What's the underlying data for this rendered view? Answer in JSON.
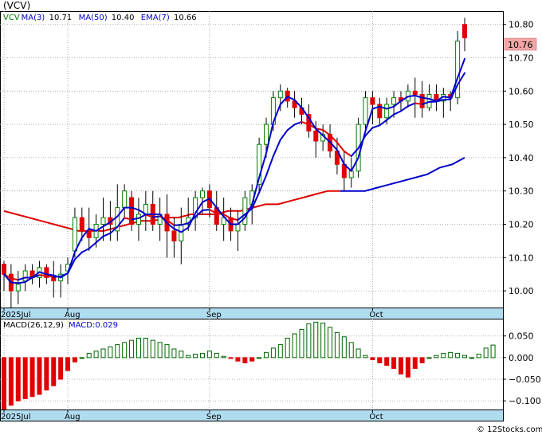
{
  "chart_data": [
    {
      "type": "candlestick",
      "ticker": "(VCV)",
      "legend": [
        {
          "label": "VCV",
          "color": "#008000"
        },
        {
          "label": "MA(3)",
          "value": "10.71",
          "color": "#0000cc"
        },
        {
          "label": "MA(50)",
          "value": "10.40",
          "color": "#0000cc"
        },
        {
          "label": "EMA(7)",
          "value": "10.66",
          "color": "#0000cc"
        }
      ],
      "last_price_label": "10.76",
      "ylim": [
        9.95,
        10.84
      ],
      "y_ticks": [
        10.0,
        10.1,
        10.2,
        10.3,
        10.4,
        10.5,
        10.6,
        10.7,
        10.8
      ],
      "x_ticks": [
        {
          "label": "2025Jul",
          "index": 0
        },
        {
          "label": "Aug",
          "index": 9
        },
        {
          "label": "Sep",
          "index": 29
        },
        {
          "label": "Oct",
          "index": 52
        }
      ],
      "ohlc": [
        [
          10.08,
          10.09,
          10.0,
          10.05
        ],
        [
          10.05,
          10.08,
          9.95,
          10.0
        ],
        [
          10.0,
          10.06,
          9.96,
          10.02
        ],
        [
          10.03,
          10.08,
          10.0,
          10.06
        ],
        [
          10.06,
          10.08,
          10.02,
          10.04
        ],
        [
          10.04,
          10.09,
          10.01,
          10.07
        ],
        [
          10.07,
          10.08,
          10.02,
          10.04
        ],
        [
          10.04,
          10.09,
          9.98,
          10.03
        ],
        [
          10.03,
          10.08,
          9.98,
          10.05
        ],
        [
          10.06,
          10.1,
          10.02,
          10.08
        ],
        [
          10.12,
          10.25,
          10.1,
          10.22
        ],
        [
          10.22,
          10.25,
          10.15,
          10.18
        ],
        [
          10.18,
          10.25,
          10.12,
          10.16
        ],
        [
          10.16,
          10.23,
          10.13,
          10.2
        ],
        [
          10.2,
          10.28,
          10.15,
          10.22
        ],
        [
          10.22,
          10.27,
          10.15,
          10.2
        ],
        [
          10.18,
          10.32,
          10.15,
          10.25
        ],
        [
          10.25,
          10.32,
          10.22,
          10.3
        ],
        [
          10.28,
          10.3,
          10.18,
          10.2
        ],
        [
          10.2,
          10.28,
          10.15,
          10.23
        ],
        [
          10.23,
          10.3,
          10.18,
          10.26
        ],
        [
          10.26,
          10.3,
          10.18,
          10.2
        ],
        [
          10.2,
          10.28,
          10.15,
          10.23
        ],
        [
          10.23,
          10.29,
          10.1,
          10.18
        ],
        [
          10.18,
          10.22,
          10.1,
          10.15
        ],
        [
          10.15,
          10.25,
          10.08,
          10.2
        ],
        [
          10.2,
          10.28,
          10.18,
          10.22
        ],
        [
          10.22,
          10.3,
          10.18,
          10.28
        ],
        [
          10.28,
          10.31,
          10.23,
          10.3
        ],
        [
          10.3,
          10.32,
          10.22,
          10.25
        ],
        [
          10.25,
          10.3,
          10.18,
          10.2
        ],
        [
          10.2,
          10.28,
          10.15,
          10.22
        ],
        [
          10.22,
          10.25,
          10.15,
          10.18
        ],
        [
          10.18,
          10.24,
          10.12,
          10.2
        ],
        [
          10.2,
          10.3,
          10.18,
          10.28
        ],
        [
          10.26,
          10.32,
          10.2,
          10.3
        ],
        [
          10.32,
          10.46,
          10.3,
          10.44
        ],
        [
          10.44,
          10.52,
          10.4,
          10.5
        ],
        [
          10.5,
          10.6,
          10.48,
          10.58
        ],
        [
          10.58,
          10.62,
          10.54,
          10.6
        ],
        [
          10.6,
          10.61,
          10.55,
          10.57
        ],
        [
          10.57,
          10.6,
          10.52,
          10.55
        ],
        [
          10.55,
          10.58,
          10.5,
          10.53
        ],
        [
          10.53,
          10.56,
          10.46,
          10.48
        ],
        [
          10.48,
          10.51,
          10.4,
          10.45
        ],
        [
          10.45,
          10.5,
          10.42,
          10.47
        ],
        [
          10.47,
          10.5,
          10.4,
          10.42
        ],
        [
          10.42,
          10.46,
          10.35,
          10.38
        ],
        [
          10.38,
          10.42,
          10.3,
          10.34
        ],
        [
          10.34,
          10.4,
          10.31,
          10.36
        ],
        [
          10.36,
          10.52,
          10.34,
          10.5
        ],
        [
          10.5,
          10.6,
          10.48,
          10.58
        ],
        [
          10.58,
          10.6,
          10.5,
          10.56
        ],
        [
          10.56,
          10.58,
          10.5,
          10.52
        ],
        [
          10.52,
          10.58,
          10.5,
          10.56
        ],
        [
          10.56,
          10.6,
          10.52,
          10.58
        ],
        [
          10.58,
          10.6,
          10.54,
          10.57
        ],
        [
          10.57,
          10.62,
          10.55,
          10.6
        ],
        [
          10.6,
          10.64,
          10.52,
          10.59
        ],
        [
          10.59,
          10.63,
          10.52,
          10.55
        ],
        [
          10.55,
          10.62,
          10.54,
          10.59
        ],
        [
          10.59,
          10.62,
          10.54,
          10.57
        ],
        [
          10.57,
          10.61,
          10.52,
          10.59
        ],
        [
          10.59,
          10.6,
          10.54,
          10.58
        ],
        [
          10.58,
          10.78,
          10.56,
          10.75
        ],
        [
          10.8,
          10.82,
          10.72,
          10.76
        ]
      ],
      "ma3": [
        10.2,
        10.18,
        10.16,
        10.17,
        10.21,
        10.25,
        10.3,
        10.33,
        10.32,
        10.31,
        10.31,
        10.32,
        10.35,
        10.36,
        10.34,
        10.33,
        10.32,
        10.33,
        10.36,
        10.38,
        10.4,
        10.42,
        10.42,
        10.44,
        10.46,
        10.5,
        10.54,
        10.58,
        10.62,
        10.71
      ],
      "ma50": [
        10.24,
        10.23,
        10.22,
        10.21,
        10.2,
        10.19,
        10.18,
        10.18,
        10.18,
        10.19,
        10.2,
        10.21,
        10.21,
        10.22,
        10.22,
        10.23,
        10.23,
        10.23,
        10.24,
        10.24,
        10.25,
        10.26,
        10.26,
        10.27,
        10.28,
        10.29,
        10.3,
        10.3,
        10.3,
        10.3,
        10.31,
        10.32,
        10.33,
        10.34,
        10.35,
        10.37,
        10.38,
        10.4
      ],
      "ema7": [
        10.22,
        10.21,
        10.2,
        10.19,
        10.2,
        10.21,
        10.22,
        10.24,
        10.26,
        10.28,
        10.29,
        10.32,
        10.36,
        10.42,
        10.47,
        10.51,
        10.53,
        10.54,
        10.53,
        10.51,
        10.48,
        10.45,
        10.44,
        10.47,
        10.5,
        10.54,
        10.57,
        10.58,
        10.59,
        10.6,
        10.66
      ]
    },
    {
      "type": "bar",
      "title": "MACD(26,12,9)",
      "value_label": "MACD:0.029",
      "ylim": [
        -0.12,
        0.09
      ],
      "y_ticks": [
        0.05,
        0.0,
        -0.05,
        -0.1
      ],
      "y_tick_labels": [
        "0.050",
        "0.000",
        "−0.050",
        "−0.100"
      ],
      "x_ticks": [
        {
          "label": "2025Jul",
          "index": 0
        },
        {
          "label": "Aug",
          "index": 9
        },
        {
          "label": "Sep",
          "index": 29
        },
        {
          "label": "Oct",
          "index": 52
        }
      ],
      "values": [
        -0.12,
        -0.11,
        -0.1,
        -0.095,
        -0.09,
        -0.085,
        -0.075,
        -0.065,
        -0.05,
        -0.03,
        -0.01,
        0.0,
        0.01,
        0.015,
        0.02,
        0.025,
        0.03,
        0.035,
        0.04,
        0.045,
        0.045,
        0.04,
        0.035,
        0.03,
        0.02,
        0.015,
        0.005,
        0.008,
        0.01,
        0.015,
        0.01,
        0.003,
        -0.002,
        -0.008,
        -0.012,
        -0.008,
        0.0,
        0.012,
        0.022,
        0.03,
        0.045,
        0.055,
        0.065,
        0.078,
        0.082,
        0.08,
        0.07,
        0.058,
        0.048,
        0.035,
        0.02,
        0.005,
        -0.005,
        -0.012,
        -0.018,
        -0.025,
        -0.038,
        -0.045,
        -0.025,
        -0.012,
        0.0,
        0.005,
        0.01,
        0.012,
        0.01,
        0.005,
        0.0,
        0.008,
        0.022,
        0.029
      ]
    }
  ],
  "footer": {
    "credit": "© 12Stocks.com"
  }
}
